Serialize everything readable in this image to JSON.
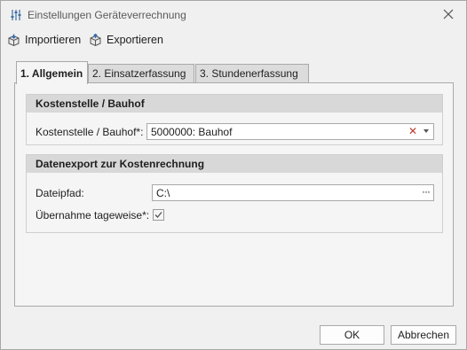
{
  "window": {
    "title": "Einstellungen Geräteverrechnung"
  },
  "toolbar": {
    "import_label": "Importieren",
    "export_label": "Exportieren"
  },
  "tabs": [
    {
      "label": "1. Allgemein",
      "active": true
    },
    {
      "label": "2. Einsatzerfassung",
      "active": false
    },
    {
      "label": "3. Stundenerfassung",
      "active": false
    }
  ],
  "cost_center_group": {
    "header": "Kostenstelle / Bauhof",
    "field_label": "Kostenstelle / Bauhof*:",
    "field_value": "5000000: Bauhof"
  },
  "export_group": {
    "header": "Datenexport zur Kostenrechnung",
    "path_label": "Dateipfad:",
    "path_value": "C:\\",
    "daily_label": "Übernahme tageweise*:",
    "daily_checked": true
  },
  "footer": {
    "ok_label": "OK",
    "cancel_label": "Abbrechen"
  },
  "icons": {
    "title": "sliders-icon",
    "close": "close-icon",
    "import": "box-import-icon",
    "export": "box-export-icon",
    "clear": "clear-x-icon",
    "dropdown": "chevron-down-icon",
    "browse": "ellipsis-icon",
    "check": "checkmark-icon"
  },
  "colors": {
    "clear_icon": "#c0392b",
    "group_header_bg": "#d8d8d8",
    "tab_inactive_bg": "#dcdcdc"
  }
}
